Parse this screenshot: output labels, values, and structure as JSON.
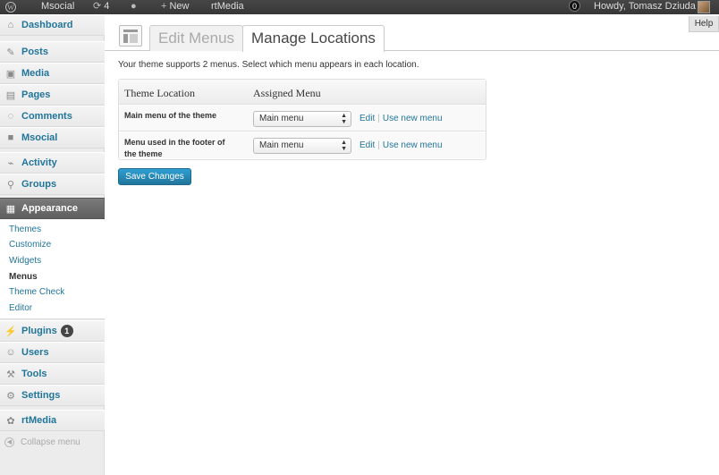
{
  "admin_bar": {
    "site_name": "Msocial",
    "updates_count": "4",
    "new_label": "New",
    "rtmedia_label": "rtMedia",
    "notifications_count": "0",
    "howdy_text": "Howdy, Tomasz Dziuda"
  },
  "sidebar": {
    "items": [
      {
        "label": "Dashboard",
        "icon": "home-icon"
      },
      {
        "label": "Posts",
        "icon": "pushpin-icon"
      },
      {
        "label": "Media",
        "icon": "media-icon"
      },
      {
        "label": "Pages",
        "icon": "pages-icon"
      },
      {
        "label": "Comments",
        "icon": "comment-icon"
      },
      {
        "label": "Msocial",
        "icon": "msocial-icon"
      },
      {
        "label": "Activity",
        "icon": "activity-icon"
      },
      {
        "label": "Groups",
        "icon": "groups-icon"
      },
      {
        "label": "Appearance",
        "icon": "appearance-icon"
      },
      {
        "label": "Plugins",
        "icon": "plugins-icon",
        "badge": "1"
      },
      {
        "label": "Users",
        "icon": "users-icon"
      },
      {
        "label": "Tools",
        "icon": "tools-icon"
      },
      {
        "label": "Settings",
        "icon": "settings-icon"
      },
      {
        "label": "rtMedia",
        "icon": "rtmedia-icon"
      }
    ],
    "submenu": [
      "Themes",
      "Customize",
      "Widgets",
      "Menus",
      "Theme Check",
      "Editor"
    ],
    "collapse_label": "Collapse menu"
  },
  "content": {
    "help_label": "Help",
    "tab_edit": "Edit Menus",
    "tab_manage": "Manage Locations",
    "intro": "Your theme supports 2 menus. Select which menu appears in each location.",
    "table": {
      "col_location": "Theme Location",
      "col_menu": "Assigned Menu",
      "rows": [
        {
          "location": "Main menu of the theme",
          "menu": "Main menu"
        },
        {
          "location": "Menu used in the footer of the theme",
          "menu": "Main menu"
        }
      ],
      "edit_label": "Edit",
      "sep": "|",
      "new_label": "Use new menu"
    },
    "save_label": "Save Changes"
  },
  "colors": {
    "link": "#21759b",
    "admin_bar": "#464646",
    "primary_button": "#21759b"
  }
}
